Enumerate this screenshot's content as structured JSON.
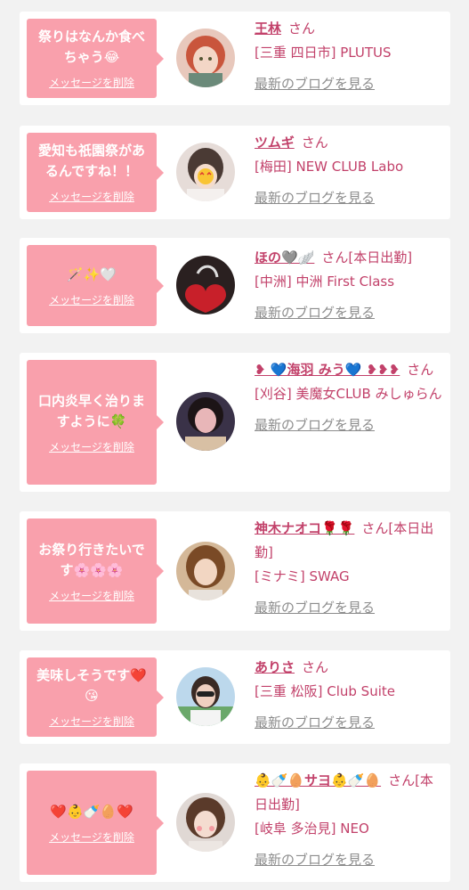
{
  "delete_label": "メッセージを削除",
  "blog_label": "最新のブログを見る",
  "san": "さん",
  "colors": {
    "bubble": "#f9a0ac",
    "name": "#c2416a",
    "link_gray": "#8c8c8c",
    "background": "#f2f2f2"
  },
  "entries": [
    {
      "message": "祭りはなんか食べちゃう😂",
      "name": "王林",
      "status": "",
      "shop": "[三重 四日市] PLUTUS",
      "avatar_icon": "avatar-photo-anime-girl"
    },
    {
      "message": "愛知も祇園祭があるんですね！！",
      "name": "ツムギ",
      "status": "",
      "shop": "[梅田] NEW CLUB Labo",
      "avatar_icon": "avatar-photo-heart-eyes"
    },
    {
      "message": "🪄✨🤍",
      "name": "ほの🩶🪽",
      "status": "[本日出勤]",
      "shop": "[中洲] 中洲 First Class",
      "avatar_icon": "avatar-photo-heart-bag"
    },
    {
      "message": "口内炎早く治りますように🍀",
      "name": "❥ 💙海羽 みう💙 ❥❥❥",
      "status": "",
      "shop": "[刈谷] 美魔女CLUB みしゅらん",
      "avatar_icon": "avatar-photo-woman"
    },
    {
      "message": "お祭り行きたいです🌸🌸🌸",
      "name": "神木ナオコ🌹🌹",
      "status": "[本日出勤]",
      "shop": "[ミナミ] SWAG",
      "avatar_icon": "avatar-photo-woman"
    },
    {
      "message": "美味しそうです❤️😘",
      "name": "ありさ",
      "status": "",
      "shop": "[三重 松阪] Club Suite",
      "avatar_icon": "avatar-photo-sunglasses"
    },
    {
      "message": "❤️👶🍼🥚❤️",
      "name": "👶🍼🥚サヨ👶🍼🥚",
      "status": "[本日出勤]",
      "shop": "[岐阜 多治見] NEO",
      "avatar_icon": "avatar-photo-woman"
    }
  ]
}
